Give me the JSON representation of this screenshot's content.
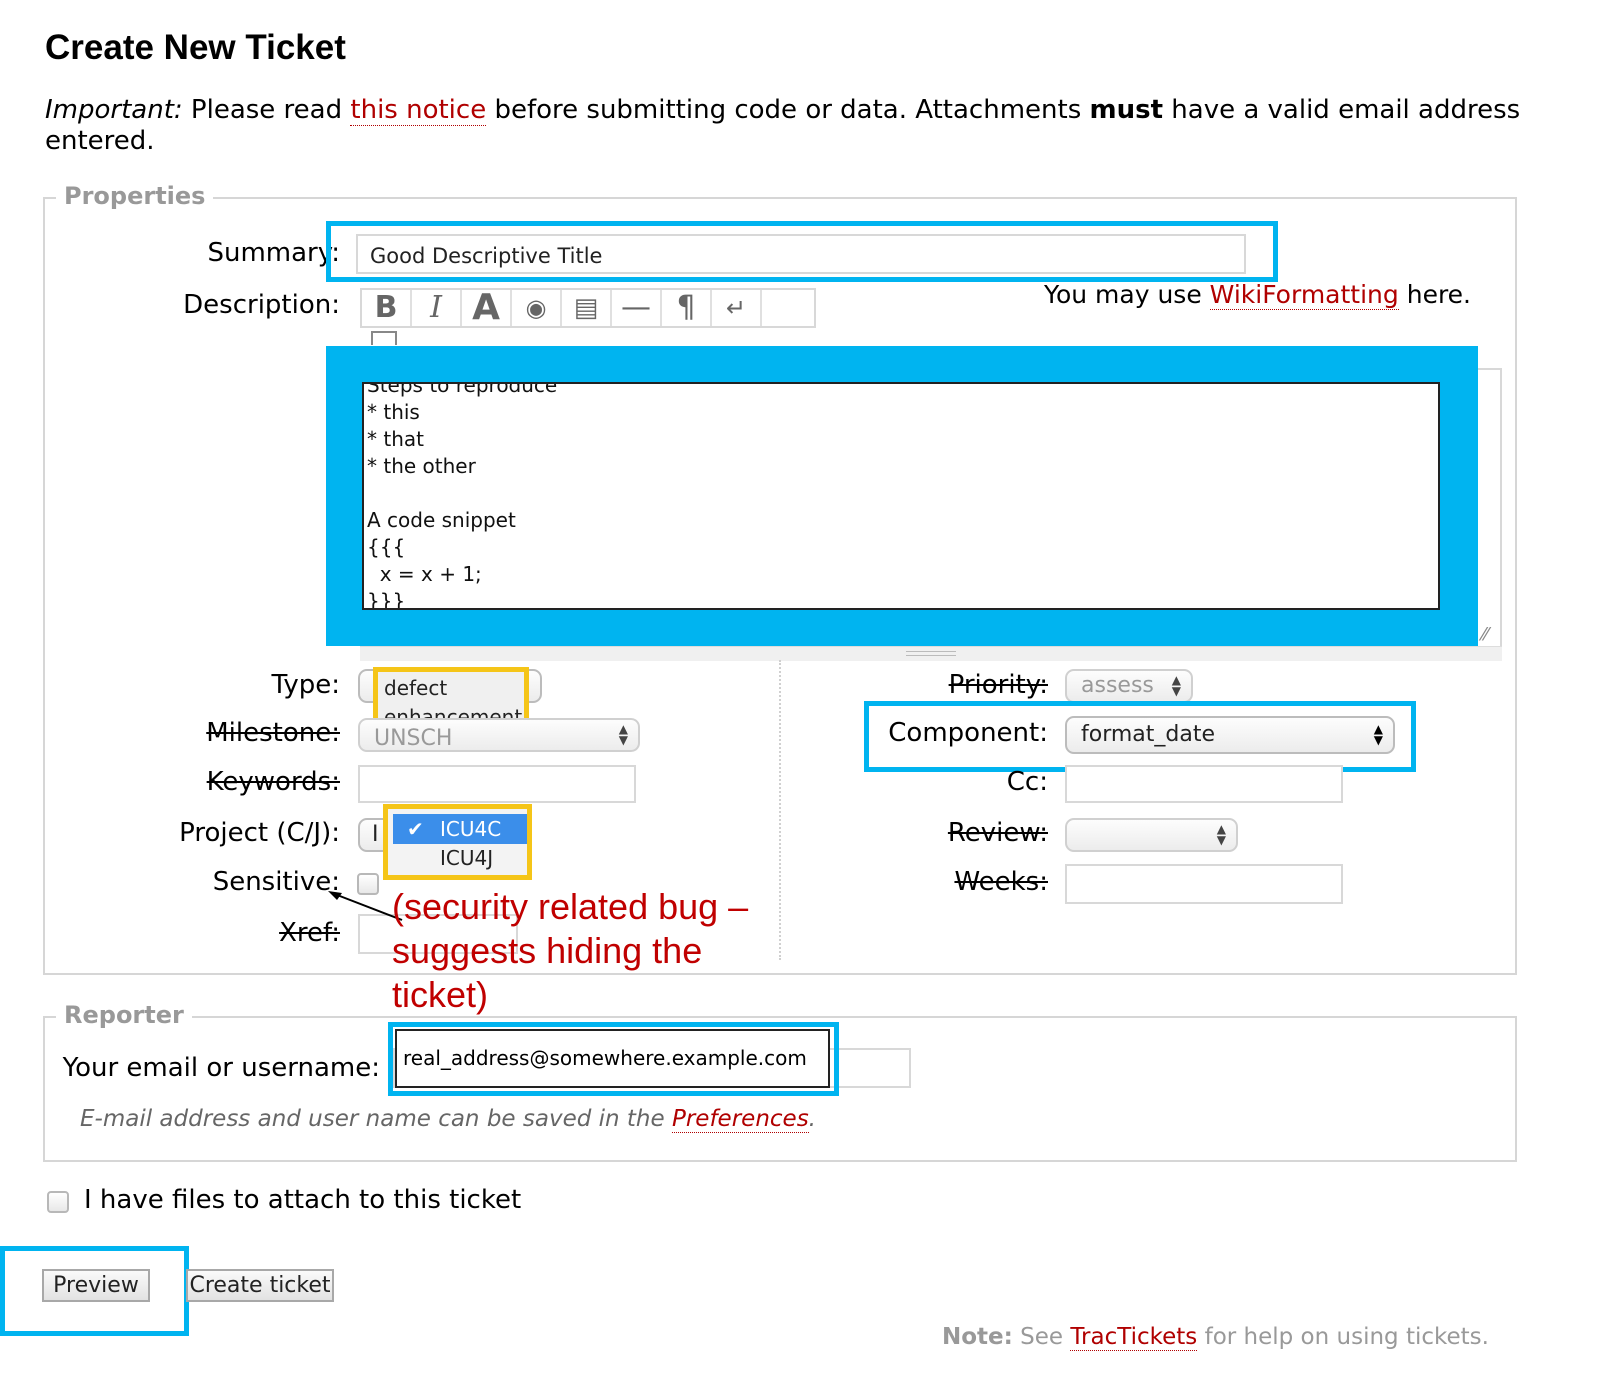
{
  "page_title": "Create New Ticket",
  "notice": {
    "important": "Important:",
    "part1": "Please read",
    "link": "this notice",
    "part2": "before submitting code or data. Attachments",
    "must": "must",
    "part3": "have a valid email address entered."
  },
  "properties": {
    "legend": "Properties",
    "summary_label": "Summary:",
    "summary_value": "Good Descriptive Title",
    "description_label": "Description:",
    "wiki_hint_pre": "You may use",
    "wiki_hint_link": "WikiFormatting",
    "wiki_hint_post": "here.",
    "toolbar": [
      "B",
      "I",
      "A",
      "◉",
      "▤",
      "—",
      "¶",
      "↵"
    ],
    "description_lines": [
      "Steps to reproduce",
      "* this",
      "* that",
      "* the other",
      "",
      "A code snippet",
      "{{{",
      "  x = x + 1;",
      "}}}"
    ],
    "type_label": "Type:",
    "type_options": [
      "defect",
      "enhancement"
    ],
    "milestone_label": "Milestone:",
    "milestone_value": "UNSCH",
    "keywords_label": "Keywords:",
    "project_label": "Project (C/J):",
    "project_value": "I",
    "project_options": [
      "ICU4C",
      "ICU4J"
    ],
    "sensitive_label": "Sensitive:",
    "xref_label": "Xref:",
    "priority_label": "Priority:",
    "priority_value": "assess",
    "component_label": "Component:",
    "component_value": "format_date",
    "cc_label": "Cc:",
    "review_label": "Review:",
    "weeks_label": "Weeks:"
  },
  "annotation": "(security related bug – suggests hiding the ticket)",
  "reporter": {
    "legend": "Reporter",
    "email_label": "Your email or username:",
    "email_value": "real_address@somewhere.example.com",
    "hint_pre": "E-mail address and user name can be saved in the",
    "hint_link": "Preferences",
    "hint_post": "."
  },
  "attach_label": "I have files to attach to this ticket",
  "buttons": {
    "preview": "Preview",
    "create": "Create ticket"
  },
  "footer": {
    "note": "Note:",
    "pre": "See",
    "link": "TracTickets",
    "post": "for help on using tickets."
  },
  "colors": {
    "highlight_blue": "#00b4f0",
    "highlight_yellow": "#f5c518",
    "link_red": "#b00000",
    "annotation_red": "#c00000"
  }
}
